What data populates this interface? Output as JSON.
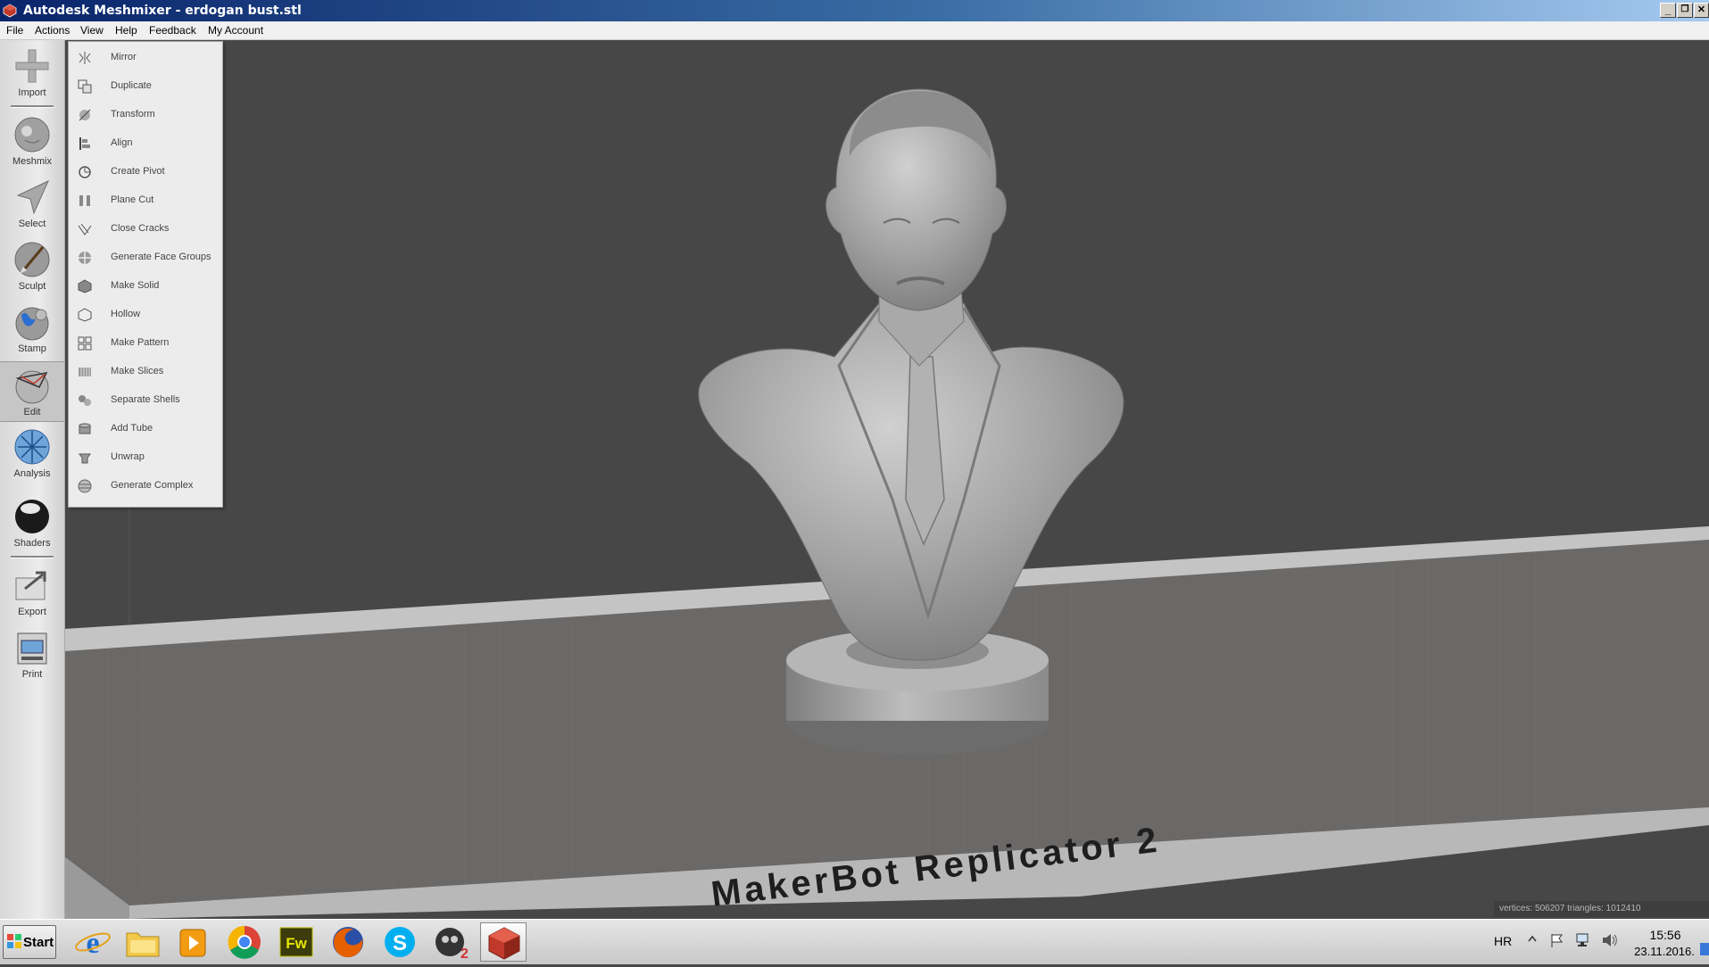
{
  "window": {
    "title": "Autodesk Meshmixer - erdogan bust.stl",
    "minimize": "_",
    "restore": "❐",
    "close": "✕"
  },
  "menubar": [
    "File",
    "Actions",
    "View",
    "Help",
    "Feedback",
    "My Account"
  ],
  "tools": [
    {
      "label": "Import",
      "icon": "plus-icon"
    },
    {
      "label": "Meshmix",
      "icon": "meshmix-icon"
    },
    {
      "label": "Select",
      "icon": "select-arrow-icon"
    },
    {
      "label": "Sculpt",
      "icon": "brush-icon"
    },
    {
      "label": "Stamp",
      "icon": "stamp-icon"
    },
    {
      "label": "Edit",
      "icon": "edit-icon"
    },
    {
      "label": "Analysis",
      "icon": "analysis-icon"
    },
    {
      "label": "Shaders",
      "icon": "shader-sphere-icon"
    },
    {
      "label": "Export",
      "icon": "export-icon"
    },
    {
      "label": "Print",
      "icon": "print-icon"
    }
  ],
  "edit_menu": [
    "Mirror",
    "Duplicate",
    "Transform",
    "Align",
    "Create Pivot",
    "Plane Cut",
    "Close Cracks",
    "Generate Face Groups",
    "Make Solid",
    "Hollow",
    "Make Pattern",
    "Make Slices",
    "Separate Shells",
    "Add Tube",
    "Unwrap",
    "Generate Complex"
  ],
  "printer_label": "MakerBot Replicator 2",
  "stats": "vertices: 506207  triangles: 1012410",
  "taskbar": {
    "start": "Start",
    "apps": [
      "internet-explorer-icon",
      "folder-icon",
      "media-player-icon",
      "chrome-icon",
      "fireworks-icon",
      "firefox-icon",
      "skype-icon",
      "app-2-icon",
      "meshmixer-icon"
    ],
    "fireworks_text": "Fw",
    "lang": "HR",
    "time": "15:56",
    "date": "23.11.2016."
  },
  "colors": {
    "viewport_bg": "#474747",
    "bed": "#6b6968",
    "bed_rim": "#c4c4c4",
    "model": "#a8a8a8"
  }
}
